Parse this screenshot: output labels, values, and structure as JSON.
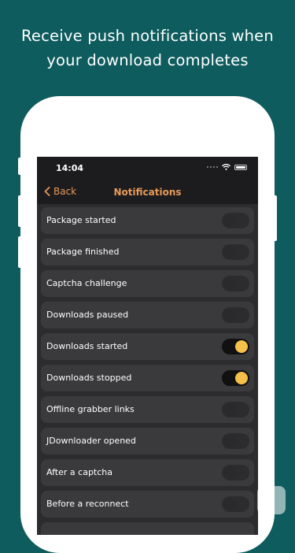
{
  "headline": {
    "line1": "Receive push notifications when",
    "line2": "your download completes"
  },
  "status_bar": {
    "time": "14:04"
  },
  "nav": {
    "back_label": "Back",
    "title": "Notifications"
  },
  "colors": {
    "background": "#0e5c5e",
    "accent": "#e79a5b",
    "toggle_on_knob": "#f5c04a"
  },
  "settings": [
    {
      "label": "Package started",
      "enabled": false
    },
    {
      "label": "Package finished",
      "enabled": false
    },
    {
      "label": "Captcha challenge",
      "enabled": false
    },
    {
      "label": "Downloads paused",
      "enabled": false
    },
    {
      "label": "Downloads started",
      "enabled": true
    },
    {
      "label": "Downloads stopped",
      "enabled": true
    },
    {
      "label": "Offline grabber links",
      "enabled": false
    },
    {
      "label": "JDownloader opened",
      "enabled": false
    },
    {
      "label": "After a captcha",
      "enabled": false
    },
    {
      "label": "Before a reconnect",
      "enabled": false
    }
  ]
}
